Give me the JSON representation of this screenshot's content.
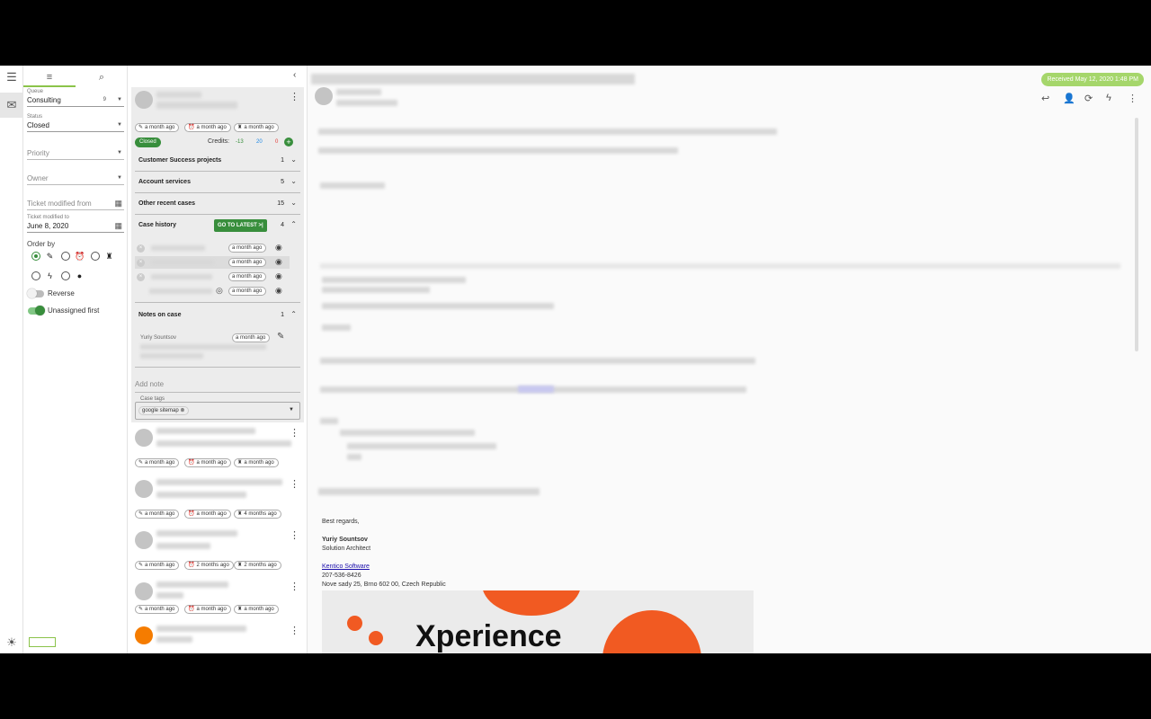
{
  "colors": {
    "accent": "#8bc34a",
    "green": "#388e3c",
    "orange": "#f15a22"
  },
  "filter": {
    "queue_label": "Queue",
    "queue_value": "Consulting",
    "queue_count": "9",
    "status_label": "Status",
    "status_value": "Closed",
    "priority_placeholder": "Priority",
    "owner_placeholder": "Owner",
    "modified_from_placeholder": "Ticket modified from",
    "modified_to_label": "Ticket modified to",
    "modified_to_value": "June 8, 2020",
    "order_by_label": "Order by",
    "reverse_label": "Reverse",
    "unassigned_first_label": "Unassigned first"
  },
  "case": {
    "chips": [
      "a month ago",
      "a month ago",
      "a month ago"
    ],
    "status": "Closed",
    "credits_label": "Credits:",
    "credits": [
      "-13",
      "20",
      "0"
    ],
    "sections": [
      {
        "title": "Customer Success projects",
        "count": "1"
      },
      {
        "title": "Account services",
        "count": "5"
      },
      {
        "title": "Other recent cases",
        "count": "15"
      },
      {
        "title": "Case history",
        "count": "4"
      }
    ],
    "goto_latest": "GO TO LATEST",
    "history_chips": [
      "a month ago",
      "a month ago",
      "a month ago",
      "a month ago"
    ],
    "notes_title": "Notes on case",
    "notes_count": "1",
    "note_author": "Yuriy Sountsov",
    "note_time": "a month ago",
    "add_note_placeholder": "Add note",
    "tags_label": "Case tags",
    "tag": "google sitemap"
  },
  "list": [
    {
      "chips": [
        "a month ago",
        "a month ago",
        "a month ago"
      ]
    },
    {
      "chips": [
        "a month ago",
        "a month ago",
        "4 months ago"
      ]
    },
    {
      "chips": [
        "a month ago",
        "2 months ago",
        "2 months ago"
      ]
    },
    {
      "chips": [
        "a month ago",
        "a month ago",
        "a month ago"
      ]
    }
  ],
  "email": {
    "received": "Received May 12, 2020 1:48 PM",
    "sig_regards": "Best regards,",
    "sig_name": "Yuriy Sountsov",
    "sig_title": "Solution Architect",
    "sig_company": "Kentico Software",
    "sig_phone": "207-536-8426",
    "sig_address": "Nove sady 25, Brno 602 00, Czech Republic",
    "banner_text": "Xperience"
  }
}
